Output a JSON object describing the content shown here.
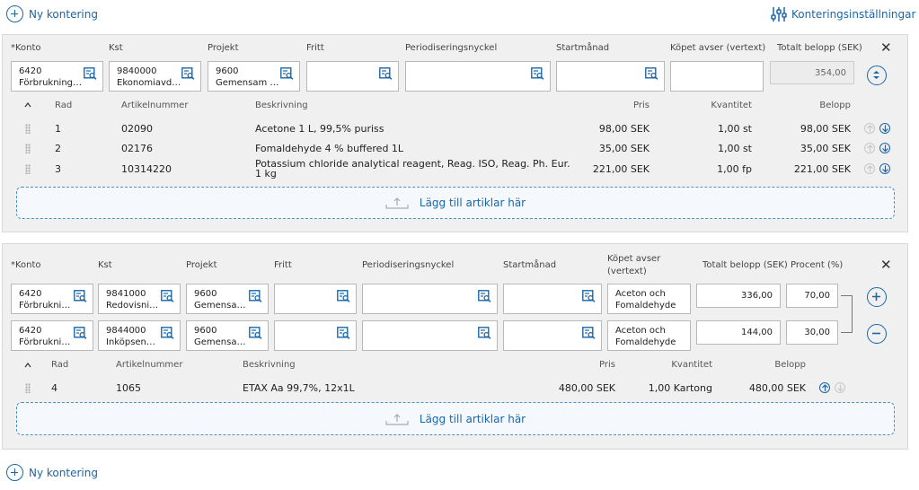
{
  "top": {
    "new_posting": "Ny kontering",
    "settings": "Konteringsinställningar"
  },
  "bottom": {
    "new_posting": "Ny kontering"
  },
  "block1": {
    "labels": {
      "konto": "*Konto",
      "kst": "Kst",
      "projekt": "Projekt",
      "fritt": "Fritt",
      "period": "Periodiseringsnyckel",
      "start": "Startmånad",
      "kopet": "Köpet avser (vertext)",
      "total": "Totalt belopp (SEK)"
    },
    "fields": {
      "konto_code": "6420",
      "konto_name": "Förbrukning…",
      "kst_code": "9840000",
      "kst_name": "Ekonomiavd…",
      "projekt_code": "9600",
      "projekt_name": "Gemensam …",
      "fritt": "",
      "period": "",
      "start": "",
      "kopet": "",
      "total": "354,00"
    },
    "table_headers": {
      "rad": "Rad",
      "artikel": "Artikelnummer",
      "beskrivning": "Beskrivning",
      "pris": "Pris",
      "kvantitet": "Kvantitet",
      "belopp": "Belopp"
    },
    "rows": [
      {
        "rad": "1",
        "artikel": "02090",
        "beskrivning": "Acetone 1 L, 99,5% puriss",
        "pris": "98,00 SEK",
        "kvantitet": "1,00 st",
        "belopp": "98,00 SEK"
      },
      {
        "rad": "2",
        "artikel": "02176",
        "beskrivning": "Fomaldehyde 4 % buffered 1L",
        "pris": "35,00 SEK",
        "kvantitet": "1,00 st",
        "belopp": "35,00 SEK"
      },
      {
        "rad": "3",
        "artikel": "10314220",
        "beskrivning_line1": "Potassium chloride analytical reagent, Reag. ISO, Reag. Ph. Eur.",
        "beskrivning_line2": "1 kg",
        "pris": "221,00 SEK",
        "kvantitet": "1,00 fp",
        "belopp": "221,00 SEK"
      }
    ],
    "dropzone": "Lägg till artiklar här"
  },
  "block2": {
    "labels": {
      "konto": "*Konto",
      "kst": "Kst",
      "projekt": "Projekt",
      "fritt": "Fritt",
      "period": "Periodiseringsnyckel",
      "start": "Startmånad",
      "kopet_line1": "Köpet avser",
      "kopet_line2": "(vertext)",
      "total": "Totalt belopp (SEK)",
      "procent": "Procent (%)"
    },
    "lines": [
      {
        "konto_code": "6420",
        "konto_name": "Förbrukni…",
        "kst_code": "9841000",
        "kst_name": "Redovisni…",
        "projekt_code": "9600",
        "projekt_name": "Gemensa…",
        "kopet_line1": "Aceton och",
        "kopet_line2": "Fomaldehyde",
        "total": "336,00",
        "procent": "70,00"
      },
      {
        "konto_code": "6420",
        "konto_name": "Förbrukni…",
        "kst_code": "9844000",
        "kst_name": "Inköpsen…",
        "projekt_code": "9600",
        "projekt_name": "Gemensa…",
        "kopet_line1": "Aceton och",
        "kopet_line2": "Fomaldehyde",
        "total": "144,00",
        "procent": "30,00"
      }
    ],
    "table_headers": {
      "rad": "Rad",
      "artikel": "Artikelnummer",
      "beskrivning": "Beskrivning",
      "pris": "Pris",
      "kvantitet": "Kvantitet",
      "belopp": "Belopp"
    },
    "rows": [
      {
        "rad": "4",
        "artikel": "1065",
        "beskrivning": "ETAX Aa 99,7%, 12x1L",
        "pris": "480,00 SEK",
        "kvantitet": "1,00 Kartong",
        "belopp": "480,00 SEK"
      }
    ],
    "dropzone": "Lägg till artiklar här"
  },
  "colors": {
    "accent": "#1a66a8",
    "panel": "#f0f0f0",
    "dropzone_border": "#4a90c8"
  }
}
